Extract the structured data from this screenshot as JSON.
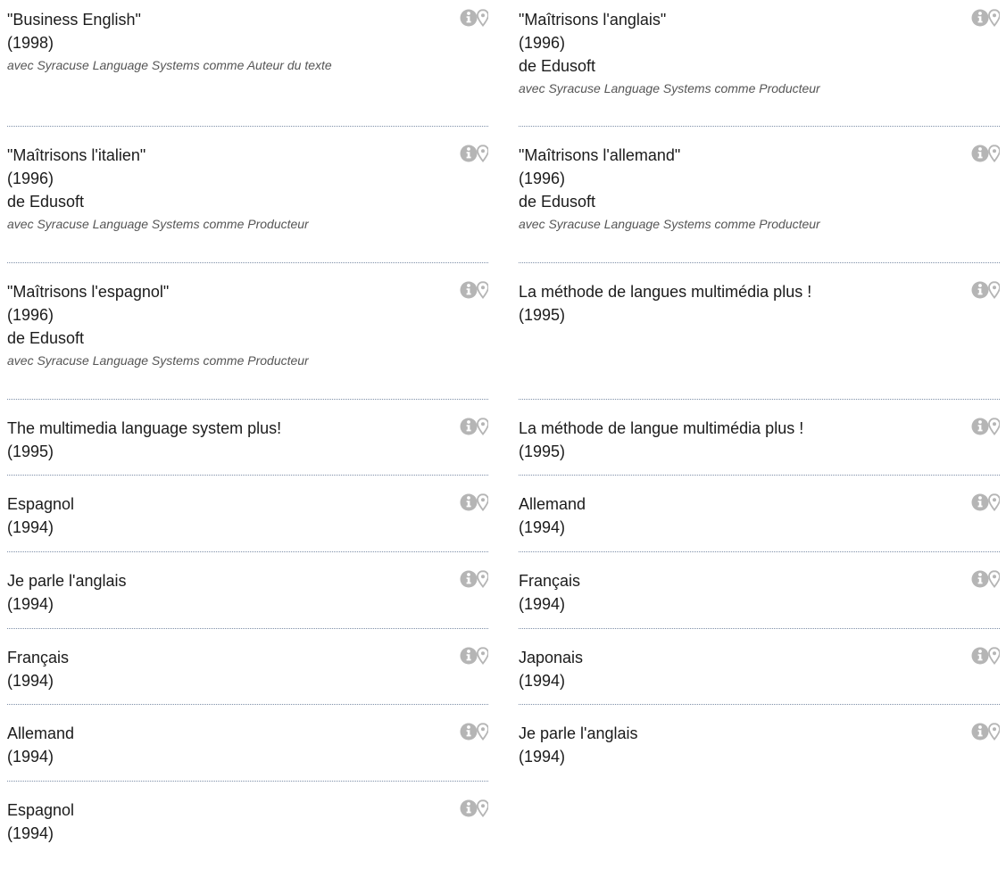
{
  "colors": {
    "text": "#1b1b1b",
    "credit_text": "#555555",
    "icon_gray": "#b5b5b5",
    "separator": "#7e8fa8"
  },
  "icons": [
    "info-icon",
    "map-pin-icon"
  ],
  "left_column": [
    {
      "title": "\"Business English\"",
      "year": "(1998)",
      "credit": "avec Syracuse Language Systems comme Auteur du texte"
    },
    {
      "title": "\"Maîtrisons l'italien\"",
      "year": "(1996)",
      "publisher": "de Edusoft",
      "credit": "avec Syracuse Language Systems comme Producteur"
    },
    {
      "title": "\"Maîtrisons l'espagnol\"",
      "year": "(1996)",
      "publisher": "de Edusoft",
      "credit": "avec Syracuse Language Systems comme Producteur"
    },
    {
      "title": "The multimedia language system plus!",
      "year": "(1995)"
    },
    {
      "title": "Espagnol",
      "year": "(1994)"
    },
    {
      "title": "Je parle l'anglais",
      "year": "(1994)"
    },
    {
      "title": "Français",
      "year": "(1994)"
    },
    {
      "title": "Allemand",
      "year": "(1994)"
    },
    {
      "title": "Espagnol",
      "year": "(1994)"
    }
  ],
  "right_column": [
    {
      "title": "\"Maîtrisons l'anglais\"",
      "year": "(1996)",
      "publisher": "de Edusoft",
      "credit": "avec Syracuse Language Systems comme Producteur"
    },
    {
      "title": "\"Maîtrisons l'allemand\"",
      "year": "(1996)",
      "publisher": "de Edusoft",
      "credit": "avec Syracuse Language Systems comme Producteur"
    },
    {
      "title": "La méthode de langues multimédia plus !",
      "year": "(1995)"
    },
    {
      "title": "La méthode de langue multimédia plus !",
      "year": "(1995)"
    },
    {
      "title": "Allemand",
      "year": "(1994)"
    },
    {
      "title": "Français",
      "year": "(1994)"
    },
    {
      "title": "Japonais",
      "year": "(1994)"
    },
    {
      "title": "Je parle l'anglais",
      "year": "(1994)"
    }
  ]
}
